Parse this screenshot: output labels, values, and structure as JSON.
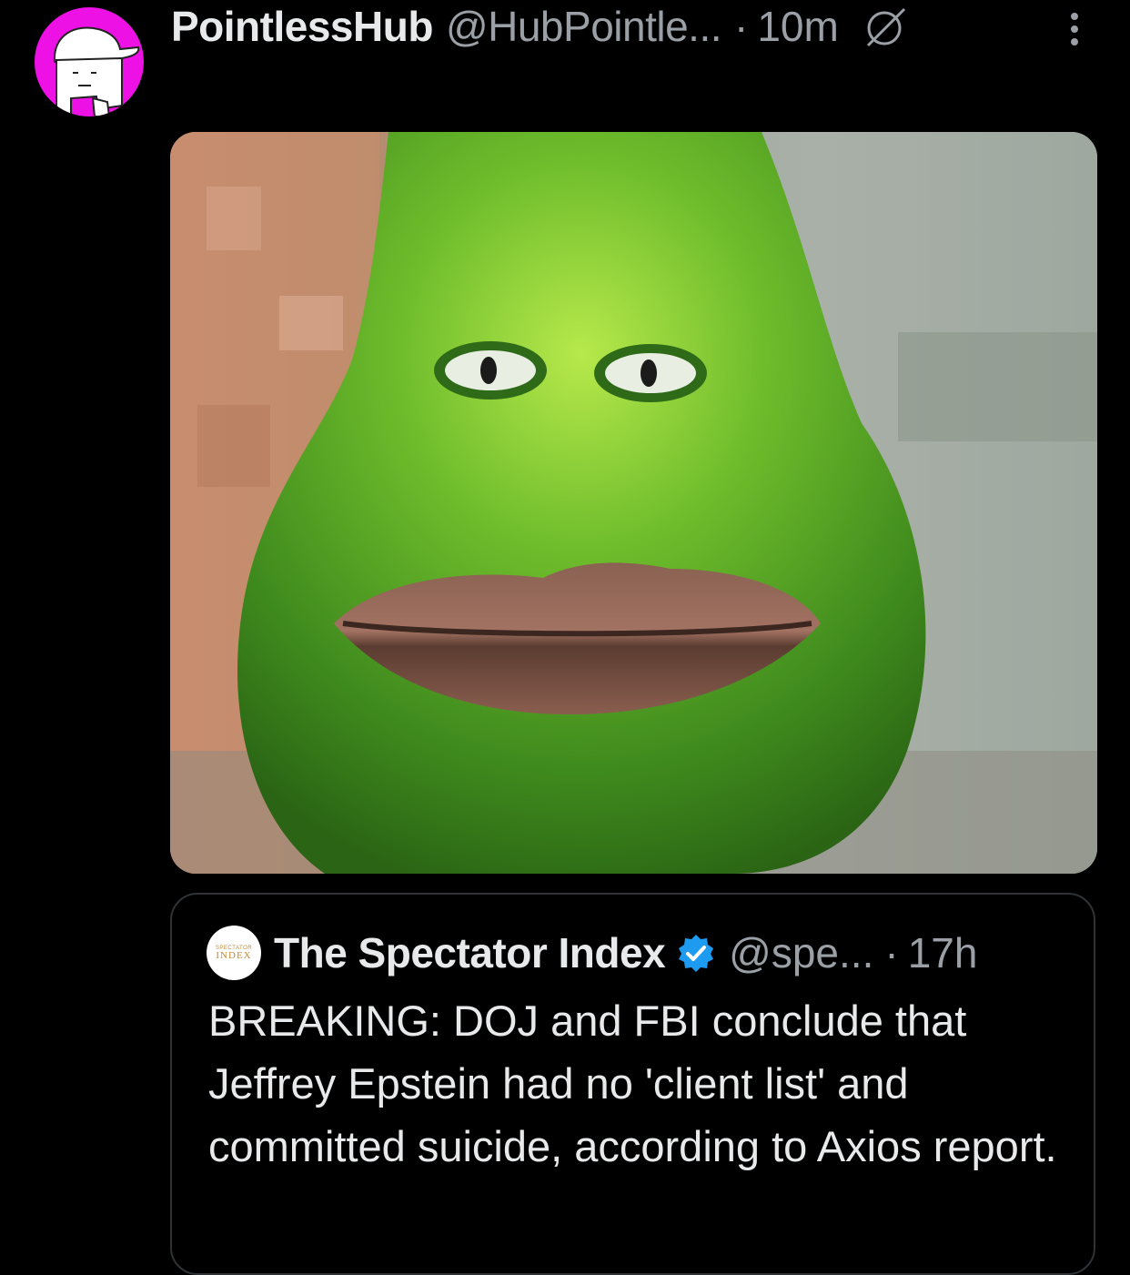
{
  "post": {
    "display_name": "PointlessHub",
    "handle": "@HubPointle...",
    "separator": "·",
    "time": "10m",
    "avatar_icon": "pointlesshub-avatar",
    "media_alt": "green pear character with eyes and lips"
  },
  "quote": {
    "avatar_text_small": "SPECTATOR",
    "avatar_text_big": "INDEX",
    "display_name": "The Spectator Index",
    "handle": "@spe...",
    "separator": "·",
    "time": "17h",
    "text": "BREAKING: DOJ and FBI conclude that Jeffrey Epstein had no 'client list' and committed suicide, according to Axios report."
  },
  "colors": {
    "background": "#000000",
    "avatar_bg": "#ee11e6",
    "verified": "#1d9bf0",
    "muted_text": "#9aa0a6",
    "border": "#2f3336"
  },
  "icons": {
    "hidden": "eye-slash-icon",
    "more": "more-vertical-icon",
    "verified": "verified-badge-icon"
  }
}
